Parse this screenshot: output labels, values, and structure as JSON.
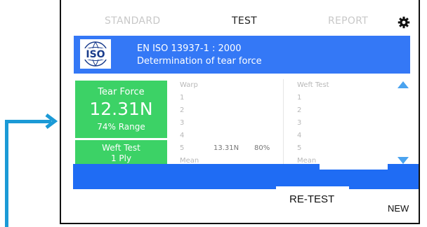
{
  "tabs": [
    {
      "label": "STANDARD",
      "state": "inactive"
    },
    {
      "label": "TEST",
      "state": "active"
    },
    {
      "label": "REPORT",
      "state": "inactive"
    }
  ],
  "settings_icon": "gear-icon",
  "standard": {
    "logo": "ISO",
    "code": "EN ISO 13937-1 : 2000",
    "title": "Determination of tear force"
  },
  "result": {
    "label": "Tear Force",
    "value": "12.31N",
    "range": "74% Range"
  },
  "current_test": {
    "name": "Weft Test",
    "ply": "1 Ply"
  },
  "warp_table": {
    "header": "Warp",
    "rows": [
      "1",
      "2",
      "3",
      "4",
      "5"
    ],
    "row5_force": "13.31N",
    "row5_percent": "80%",
    "footer": "Mean"
  },
  "weft_table": {
    "header": "Weft Test",
    "rows": [
      "1",
      "2",
      "3",
      "4",
      "5"
    ],
    "footer": "Mean"
  },
  "buttons": {
    "retest": "RE-TEST",
    "new": "NEW"
  },
  "colors": {
    "accent_blue": "#3478f6",
    "green": "#3cd266",
    "annotation": "#1b9ad6",
    "scroll_arrow": "#4aa3ef"
  }
}
